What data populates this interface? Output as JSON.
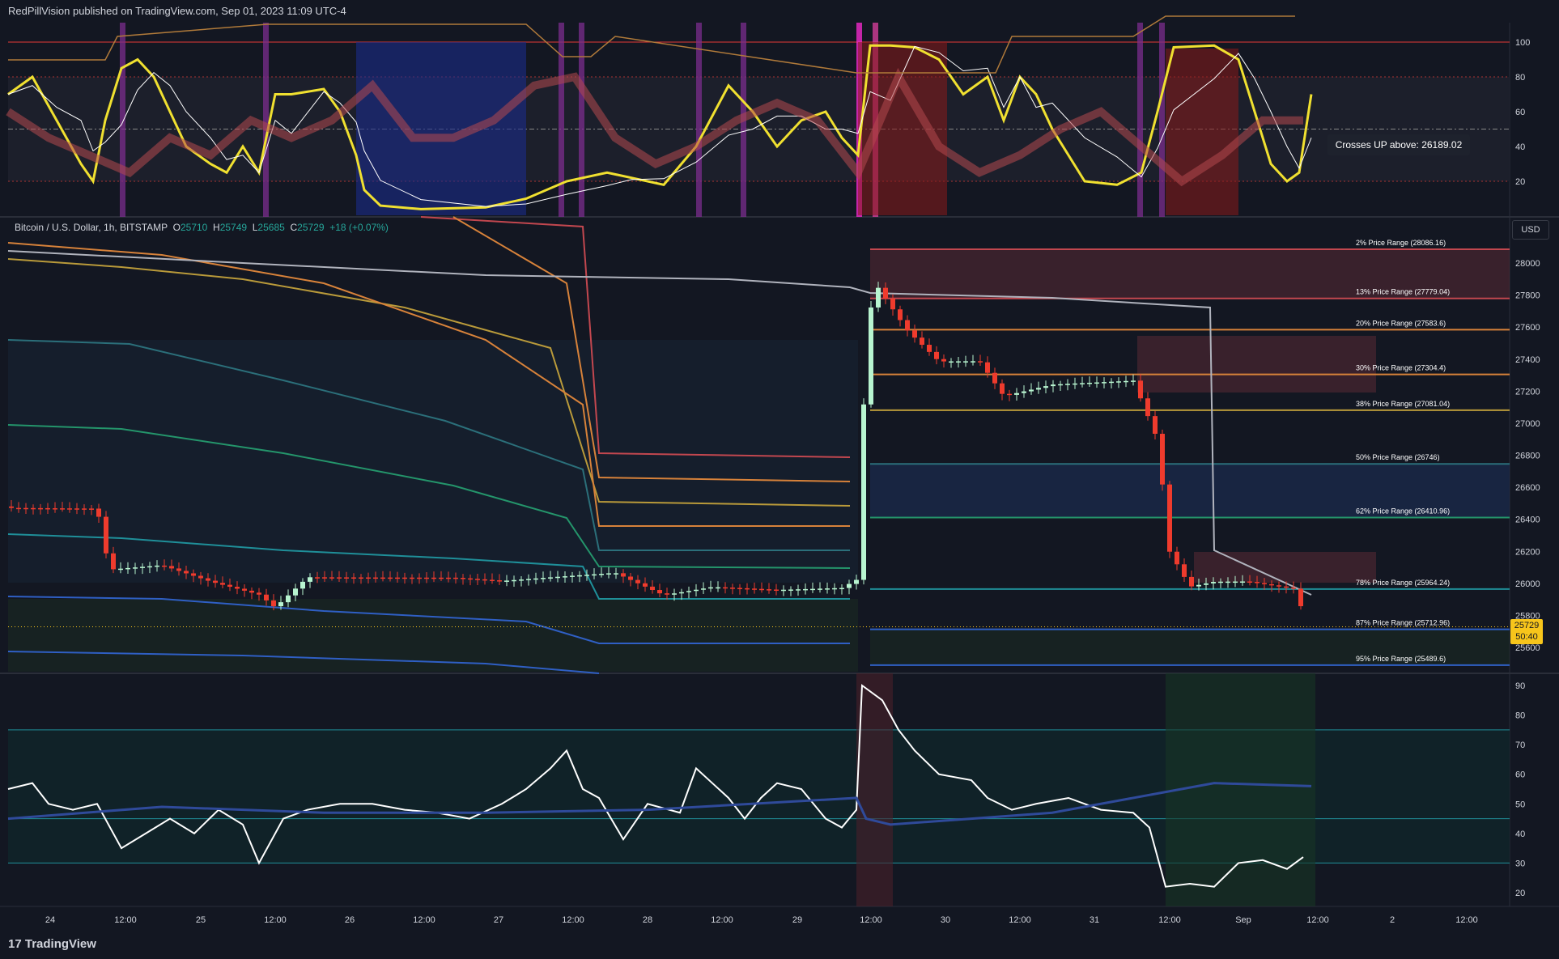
{
  "header": {
    "publisher": "RedPillVision published on TradingView.com, Sep 01, 2023 11:09 UTC-4"
  },
  "symbol": {
    "name": "Bitcoin / U.S. Dollar, 1h, BITSTAMP",
    "open_label": "O",
    "open": "25710",
    "high_label": "H",
    "high": "25749",
    "low_label": "L",
    "low": "25685",
    "close_label": "C",
    "close": "25729",
    "change": "+18 (+0.07%)"
  },
  "currency_button": "USD",
  "tooltip": "Crosses UP above: 26189.02",
  "price_badge": {
    "price": "25729",
    "countdown": "50:40"
  },
  "oscillator_axis": [
    "100",
    "80",
    "60",
    "40",
    "20"
  ],
  "price_axis": [
    "28000",
    "27800",
    "27600",
    "27400",
    "27200",
    "27000",
    "26800",
    "26600",
    "26400",
    "26200",
    "26000",
    "25800",
    "25600"
  ],
  "lower_axis": [
    "90",
    "80",
    "70",
    "60",
    "50",
    "40",
    "30",
    "20"
  ],
  "time_axis": [
    "24",
    "12:00",
    "25",
    "12:00",
    "26",
    "12:00",
    "27",
    "12:00",
    "28",
    "12:00",
    "29",
    "12:00",
    "30",
    "12:00",
    "31",
    "12:00",
    "Sep",
    "12:00",
    "2",
    "12:00"
  ],
  "price_ranges": [
    {
      "label": "2% Price Range",
      "value": "(28086.16)",
      "color": "#c2474f"
    },
    {
      "label": "13% Price Range",
      "value": "(27779.04)",
      "color": "#c2474f"
    },
    {
      "label": "20% Price Range",
      "value": "(27583.6)",
      "color": "#d7823a"
    },
    {
      "label": "30% Price Range",
      "value": "(27304.4)",
      "color": "#d7823a"
    },
    {
      "label": "38% Price Range",
      "value": "(27081.04)",
      "color": "#b99a3a"
    },
    {
      "label": "50% Price Range",
      "value": "(26746)",
      "color": "#2b6f7a"
    },
    {
      "label": "62% Price Range",
      "value": "(26410.96)",
      "color": "#24956b"
    },
    {
      "label": "78% Price Range",
      "value": "(25964.24)",
      "color": "#1f8f99"
    },
    {
      "label": "87% Price Range",
      "value": "(25712.96)",
      "color": "#2f5fc4"
    },
    {
      "label": "95% Price Range",
      "value": "(25489.6)",
      "color": "#2f5fc4"
    }
  ],
  "footer": {
    "logo_text": "TradingView"
  },
  "colors": {
    "background": "#131722",
    "grid": "#2a2e39",
    "up": "#26a69a",
    "down": "#ef5350",
    "accent": "#f7c51b"
  }
}
